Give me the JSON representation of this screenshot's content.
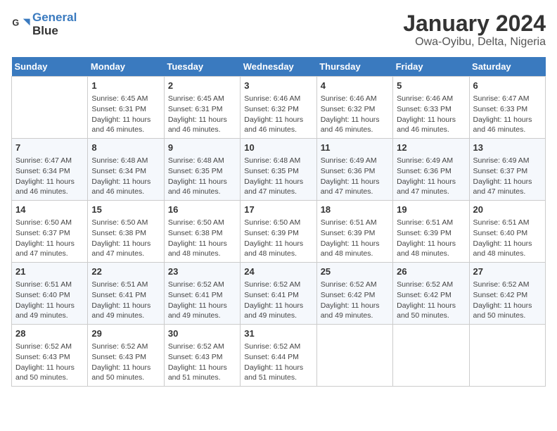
{
  "logo": {
    "line1": "General",
    "line2": "Blue"
  },
  "title": "January 2024",
  "subtitle": "Owa-Oyibu, Delta, Nigeria",
  "days_header": [
    "Sunday",
    "Monday",
    "Tuesday",
    "Wednesday",
    "Thursday",
    "Friday",
    "Saturday"
  ],
  "weeks": [
    [
      {
        "num": "",
        "text": ""
      },
      {
        "num": "1",
        "text": "Sunrise: 6:45 AM\nSunset: 6:31 PM\nDaylight: 11 hours\nand 46 minutes."
      },
      {
        "num": "2",
        "text": "Sunrise: 6:45 AM\nSunset: 6:31 PM\nDaylight: 11 hours\nand 46 minutes."
      },
      {
        "num": "3",
        "text": "Sunrise: 6:46 AM\nSunset: 6:32 PM\nDaylight: 11 hours\nand 46 minutes."
      },
      {
        "num": "4",
        "text": "Sunrise: 6:46 AM\nSunset: 6:32 PM\nDaylight: 11 hours\nand 46 minutes."
      },
      {
        "num": "5",
        "text": "Sunrise: 6:46 AM\nSunset: 6:33 PM\nDaylight: 11 hours\nand 46 minutes."
      },
      {
        "num": "6",
        "text": "Sunrise: 6:47 AM\nSunset: 6:33 PM\nDaylight: 11 hours\nand 46 minutes."
      }
    ],
    [
      {
        "num": "7",
        "text": "Sunrise: 6:47 AM\nSunset: 6:34 PM\nDaylight: 11 hours\nand 46 minutes."
      },
      {
        "num": "8",
        "text": "Sunrise: 6:48 AM\nSunset: 6:34 PM\nDaylight: 11 hours\nand 46 minutes."
      },
      {
        "num": "9",
        "text": "Sunrise: 6:48 AM\nSunset: 6:35 PM\nDaylight: 11 hours\nand 46 minutes."
      },
      {
        "num": "10",
        "text": "Sunrise: 6:48 AM\nSunset: 6:35 PM\nDaylight: 11 hours\nand 47 minutes."
      },
      {
        "num": "11",
        "text": "Sunrise: 6:49 AM\nSunset: 6:36 PM\nDaylight: 11 hours\nand 47 minutes."
      },
      {
        "num": "12",
        "text": "Sunrise: 6:49 AM\nSunset: 6:36 PM\nDaylight: 11 hours\nand 47 minutes."
      },
      {
        "num": "13",
        "text": "Sunrise: 6:49 AM\nSunset: 6:37 PM\nDaylight: 11 hours\nand 47 minutes."
      }
    ],
    [
      {
        "num": "14",
        "text": "Sunrise: 6:50 AM\nSunset: 6:37 PM\nDaylight: 11 hours\nand 47 minutes."
      },
      {
        "num": "15",
        "text": "Sunrise: 6:50 AM\nSunset: 6:38 PM\nDaylight: 11 hours\nand 47 minutes."
      },
      {
        "num": "16",
        "text": "Sunrise: 6:50 AM\nSunset: 6:38 PM\nDaylight: 11 hours\nand 48 minutes."
      },
      {
        "num": "17",
        "text": "Sunrise: 6:50 AM\nSunset: 6:39 PM\nDaylight: 11 hours\nand 48 minutes."
      },
      {
        "num": "18",
        "text": "Sunrise: 6:51 AM\nSunset: 6:39 PM\nDaylight: 11 hours\nand 48 minutes."
      },
      {
        "num": "19",
        "text": "Sunrise: 6:51 AM\nSunset: 6:39 PM\nDaylight: 11 hours\nand 48 minutes."
      },
      {
        "num": "20",
        "text": "Sunrise: 6:51 AM\nSunset: 6:40 PM\nDaylight: 11 hours\nand 48 minutes."
      }
    ],
    [
      {
        "num": "21",
        "text": "Sunrise: 6:51 AM\nSunset: 6:40 PM\nDaylight: 11 hours\nand 49 minutes."
      },
      {
        "num": "22",
        "text": "Sunrise: 6:51 AM\nSunset: 6:41 PM\nDaylight: 11 hours\nand 49 minutes."
      },
      {
        "num": "23",
        "text": "Sunrise: 6:52 AM\nSunset: 6:41 PM\nDaylight: 11 hours\nand 49 minutes."
      },
      {
        "num": "24",
        "text": "Sunrise: 6:52 AM\nSunset: 6:41 PM\nDaylight: 11 hours\nand 49 minutes."
      },
      {
        "num": "25",
        "text": "Sunrise: 6:52 AM\nSunset: 6:42 PM\nDaylight: 11 hours\nand 49 minutes."
      },
      {
        "num": "26",
        "text": "Sunrise: 6:52 AM\nSunset: 6:42 PM\nDaylight: 11 hours\nand 50 minutes."
      },
      {
        "num": "27",
        "text": "Sunrise: 6:52 AM\nSunset: 6:42 PM\nDaylight: 11 hours\nand 50 minutes."
      }
    ],
    [
      {
        "num": "28",
        "text": "Sunrise: 6:52 AM\nSunset: 6:43 PM\nDaylight: 11 hours\nand 50 minutes."
      },
      {
        "num": "29",
        "text": "Sunrise: 6:52 AM\nSunset: 6:43 PM\nDaylight: 11 hours\nand 50 minutes."
      },
      {
        "num": "30",
        "text": "Sunrise: 6:52 AM\nSunset: 6:43 PM\nDaylight: 11 hours\nand 51 minutes."
      },
      {
        "num": "31",
        "text": "Sunrise: 6:52 AM\nSunset: 6:44 PM\nDaylight: 11 hours\nand 51 minutes."
      },
      {
        "num": "",
        "text": ""
      },
      {
        "num": "",
        "text": ""
      },
      {
        "num": "",
        "text": ""
      }
    ]
  ]
}
